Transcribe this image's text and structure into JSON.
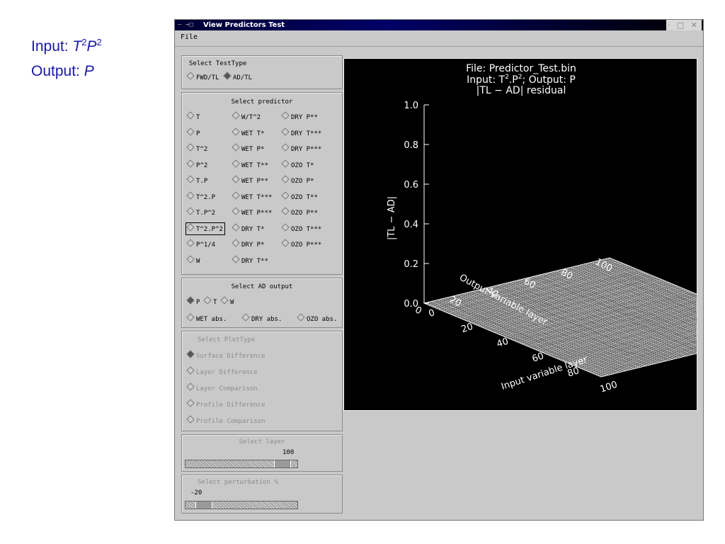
{
  "side_text": {
    "input_label": "Input: ",
    "input_t": "T",
    "input_t_exp": "2",
    "input_p": "P",
    "input_p_exp": "2",
    "output_label": "Output: ",
    "output_p": "P"
  },
  "window": {
    "title": "View Predictors Test",
    "left_controls": "— →□",
    "right_controls": "· □ ✕",
    "menu_file": "File"
  },
  "testtype": {
    "title": "Select TestType",
    "options": [
      {
        "label": "FWD/TL",
        "selected": false
      },
      {
        "label": "AD/TL",
        "selected": true
      }
    ]
  },
  "predictor": {
    "title": "Select predictor",
    "rows": [
      [
        "T",
        "W/T^2",
        "DRY P**"
      ],
      [
        "P",
        "WET T*",
        "DRY T***"
      ],
      [
        "T^2",
        "WET P*",
        "DRY P***"
      ],
      [
        "P^2",
        "WET T**",
        "OZO T*"
      ],
      [
        "T.P",
        "WET P**",
        "OZO P*"
      ],
      [
        "T^2.P",
        "WET T***",
        "OZO T**"
      ],
      [
        "T.P^2",
        "WET P***",
        "OZO P**"
      ],
      [
        "T^2.P^2",
        "DRY T*",
        "OZO T***"
      ],
      [
        "P^1/4",
        "DRY P*",
        "OZO P***"
      ],
      [
        "W",
        "DRY T**",
        ""
      ]
    ],
    "selected": "T^2.P^2"
  },
  "ad_output": {
    "title": "Select AD output",
    "row1": [
      {
        "label": "P",
        "selected": true
      },
      {
        "label": "T",
        "selected": false
      },
      {
        "label": "W",
        "selected": false
      }
    ],
    "row2": [
      {
        "label": "WET abs.",
        "selected": false
      },
      {
        "label": "DRY abs.",
        "selected": false
      },
      {
        "label": "OZO abs.",
        "selected": false
      }
    ]
  },
  "plottype": {
    "title": "Select PlotType",
    "options": [
      {
        "label": "Surface Difference",
        "selected": true
      },
      {
        "label": "Layer Difference",
        "selected": false
      },
      {
        "label": "Layer Comparison",
        "selected": false
      },
      {
        "label": "Profile Difference",
        "selected": false
      },
      {
        "label": "Profile Comparison",
        "selected": false
      }
    ]
  },
  "layer": {
    "title": "Select layer",
    "value": "100",
    "fraction": 0.92
  },
  "perturbation": {
    "title": "Select perturbation %",
    "value": "-20",
    "fraction": 0.1
  },
  "chart_data": {
    "type": "surface",
    "title_line1": "File: Predictor_Test.bin",
    "title_line2_a": "Input: T",
    "title_line2_b": "2",
    "title_line2_c": ".P",
    "title_line2_d": "2",
    "title_line2_e": ";    Output: P",
    "title_line3": "|TL − AD| residual",
    "zlabel": "|TL − AD|",
    "xlabel": "Input variable layer",
    "ylabel": "Output variable layer",
    "z_ticks": [
      "0.0",
      "0.2",
      "0.4",
      "0.6",
      "0.8",
      "1.0"
    ],
    "x_ticks": [
      "0",
      "20",
      "40",
      "60",
      "80",
      "100"
    ],
    "y_ticks": [
      "0",
      "20",
      "40",
      "60",
      "80",
      "100"
    ],
    "zlim": [
      0,
      1.0
    ],
    "xlim": [
      0,
      100
    ],
    "ylim": [
      0,
      100
    ],
    "surface_value": 0.0
  }
}
